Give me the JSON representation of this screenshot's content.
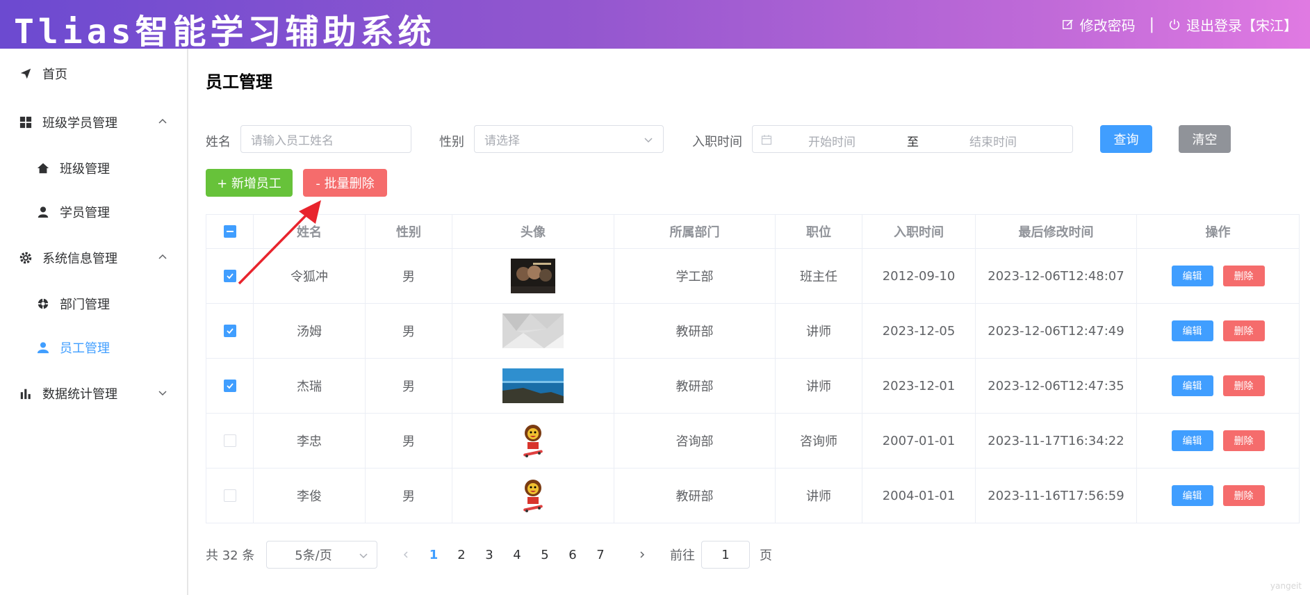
{
  "header": {
    "title": "Tlias智能学习辅助系统",
    "change_password": "修改密码",
    "separator": "|",
    "logout": "退出登录【宋江】"
  },
  "sidebar": {
    "items": [
      {
        "label": "首页",
        "icon": "paper-plane-icon"
      },
      {
        "label": "班级学员管理",
        "icon": "grid-icon",
        "expanded": true
      },
      {
        "label": "班级管理",
        "icon": "home-icon"
      },
      {
        "label": "学员管理",
        "icon": "user-icon"
      },
      {
        "label": "系统信息管理",
        "icon": "gear-icon",
        "expanded": true
      },
      {
        "label": "部门管理",
        "icon": "aim-icon"
      },
      {
        "label": "员工管理",
        "icon": "avatar-icon",
        "active": true
      },
      {
        "label": "数据统计管理",
        "icon": "bar-chart-icon",
        "expanded": false
      }
    ]
  },
  "page": {
    "title": "员工管理"
  },
  "filters": {
    "name_label": "姓名",
    "name_placeholder": "请输入员工姓名",
    "gender_label": "性别",
    "gender_placeholder": "请选择",
    "date_label": "入职时间",
    "date_start_placeholder": "开始时间",
    "date_to": "至",
    "date_end_placeholder": "结束时间",
    "query_button": "查询",
    "clear_button": "清空"
  },
  "actions": {
    "add_button": "+ 新增员工",
    "batch_delete_button": "- 批量删除"
  },
  "table": {
    "columns": [
      "姓名",
      "性别",
      "头像",
      "所属部门",
      "职位",
      "入职时间",
      "最后修改时间",
      "操作"
    ],
    "edit_label": "编辑",
    "delete_label": "删除",
    "rows": [
      {
        "name": "令狐冲",
        "gender": "男",
        "avatar": "movie-poster",
        "dept": "学工部",
        "job": "班主任",
        "entry": "2012-09-10",
        "updated": "2023-12-06T12:48:07",
        "checked": true
      },
      {
        "name": "汤姆",
        "gender": "男",
        "avatar": "grey-polygon",
        "dept": "教研部",
        "job": "讲师",
        "entry": "2023-12-05",
        "updated": "2023-12-06T12:47:49",
        "checked": true
      },
      {
        "name": "杰瑞",
        "gender": "男",
        "avatar": "seascape",
        "dept": "教研部",
        "job": "讲师",
        "entry": "2023-12-01",
        "updated": "2023-12-06T12:47:35",
        "checked": true
      },
      {
        "name": "李忠",
        "gender": "男",
        "avatar": "cartoon-skater",
        "dept": "咨询部",
        "job": "咨询师",
        "entry": "2007-01-01",
        "updated": "2023-11-17T16:34:22",
        "checked": false
      },
      {
        "name": "李俊",
        "gender": "男",
        "avatar": "cartoon-skater",
        "dept": "教研部",
        "job": "讲师",
        "entry": "2004-01-01",
        "updated": "2023-11-16T17:56:59",
        "checked": false
      }
    ]
  },
  "pagination": {
    "total_text": "共 32 条",
    "page_size": "5条/页",
    "pages": [
      "1",
      "2",
      "3",
      "4",
      "5",
      "6",
      "7"
    ],
    "current": "1",
    "goto_label": "前往",
    "goto_value": "1",
    "page_suffix": "页"
  },
  "watermark": "yangeit",
  "colors": {
    "primary": "#409eff",
    "success": "#67c23a",
    "danger": "#f56c6c",
    "info": "#909399",
    "header_gradient_start": "#6c4ad0",
    "header_gradient_end": "#e07ae2",
    "annotation_arrow": "#e8242d"
  }
}
